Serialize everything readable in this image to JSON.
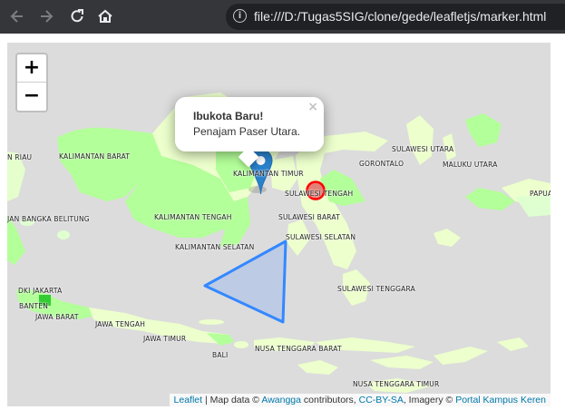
{
  "browser": {
    "url": "file:///D:/Tugas5SIG/clone/gede/leafletjs/marker.html",
    "info_icon": "i",
    "back_icon": "arrow-left",
    "forward_icon": "arrow-right",
    "reload_icon": "reload",
    "home_icon": "home"
  },
  "map": {
    "zoom_in": "+",
    "zoom_out": "−",
    "popup": {
      "title": "Ibukota Baru!",
      "body": "Penajam Paser Utara.",
      "close": "×"
    },
    "colors": {
      "background": "#dcdcdc",
      "land_green": "#b3ff99",
      "land_pale": "#ecffcc",
      "polygon_stroke": "#3388ff",
      "polygon_fill": "#b8c8e6",
      "circle_stroke": "#ff0000",
      "marker": "#2a81cb"
    },
    "labels": {
      "riau": "N RIAU",
      "kalbar": "KALIMANTAN BARAT",
      "kaltim": "KALIMANTAN TIMUR",
      "sulut": "SULAWESI UTARA",
      "gorontalo": "GORONTALO",
      "malut": "MALUKU UTARA",
      "sulteng": "SULAWESI TENGAH",
      "papua": "PAPUA",
      "babel": "JAN BANGKA BELITUNG",
      "kalteng": "KALIMANTAN TENGAH",
      "sulbar": "SULAWESI BARAT",
      "sulsel": "SULAWESI SELATAN",
      "kalsel": "KALIMANTAN SELATAN",
      "sultra": "SULAWESI TENGGARA",
      "dki": "DKI JAKARTA",
      "banten": "BANTEN",
      "jabar": "JAWA BARAT",
      "jateng": "JAWA TENGAH",
      "jatim": "JAWA TIMUR",
      "bali": "BALI",
      "ntb": "NUSA TENGGARA BARAT",
      "ntt": "NUSA TENGGARA TIMUR"
    },
    "attribution": {
      "leaflet": "Leaflet",
      "sep": " | Map data © ",
      "awangga": "Awangga",
      "contributors": " contributors, ",
      "license": "CC-BY-SA",
      "imagery": ", Imagery © ",
      "portal": "Portal Kampus Keren"
    }
  }
}
